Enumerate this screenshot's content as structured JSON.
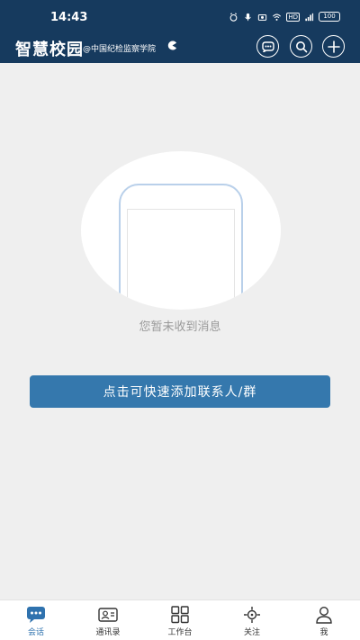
{
  "status_bar": {
    "time": "14:43",
    "hd": "HD",
    "battery": "100"
  },
  "header": {
    "title": "智慧校园",
    "subtitle": "@中国纪检监察学院",
    "icons": [
      "chat-bubble-icon",
      "search-icon",
      "plus-icon"
    ]
  },
  "empty_state": {
    "message": "您暂未收到消息",
    "button_label": "点击可快速添加联系人/群"
  },
  "tabs": [
    {
      "label": "会话",
      "icon": "chat-icon",
      "active": true
    },
    {
      "label": "通讯录",
      "icon": "contacts-card-icon",
      "active": false
    },
    {
      "label": "工作台",
      "icon": "grid-icon",
      "active": false
    },
    {
      "label": "关注",
      "icon": "target-icon",
      "active": false
    },
    {
      "label": "我",
      "icon": "person-icon",
      "active": false
    }
  ],
  "colors": {
    "header_bg": "#163a5e",
    "accent": "#3578ad",
    "tab_active": "#2f72ae"
  }
}
